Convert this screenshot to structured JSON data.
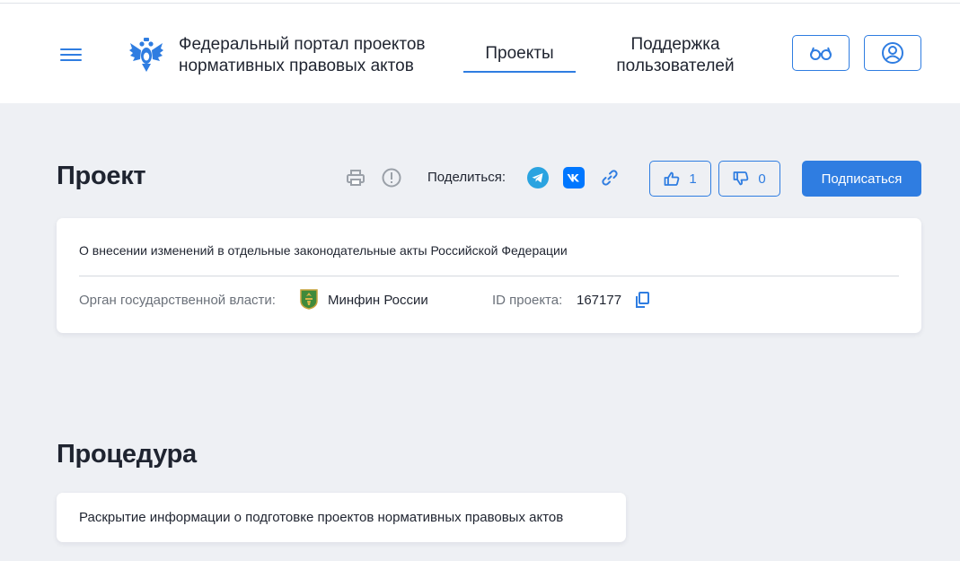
{
  "header": {
    "portal_title_line1": "Федеральный портал проектов",
    "portal_title_line2": "нормативных правовых актов",
    "nav_projects": "Проекты",
    "nav_support_line1": "Поддержка",
    "nav_support_line2": "пользователей"
  },
  "project": {
    "section_title": "Проект",
    "share_label": "Поделиться:",
    "likes": "1",
    "dislikes": "0",
    "subscribe_label": "Подписаться",
    "name": "О внесении изменений в отдельные законодательные акты Российской Федерации",
    "authority_label": "Орган государственной власти:",
    "authority_value": "Минфин России",
    "id_label": "ID проекта:",
    "id_value": "167177"
  },
  "procedure": {
    "section_title": "Процедура",
    "text": "Раскрытие информации о подготовке проектов нормативных правовых актов"
  },
  "colors": {
    "accent": "#2f7de1",
    "page_background": "#eef0f4",
    "telegram": "#2aa3e0",
    "vk": "#0077ff"
  },
  "icons": [
    "menu-icon",
    "emblem-icon",
    "glasses-icon",
    "user-icon",
    "print-icon",
    "alert-icon",
    "telegram-icon",
    "vk-icon",
    "link-icon",
    "thumbs-up-icon",
    "thumbs-down-icon",
    "copy-icon"
  ]
}
